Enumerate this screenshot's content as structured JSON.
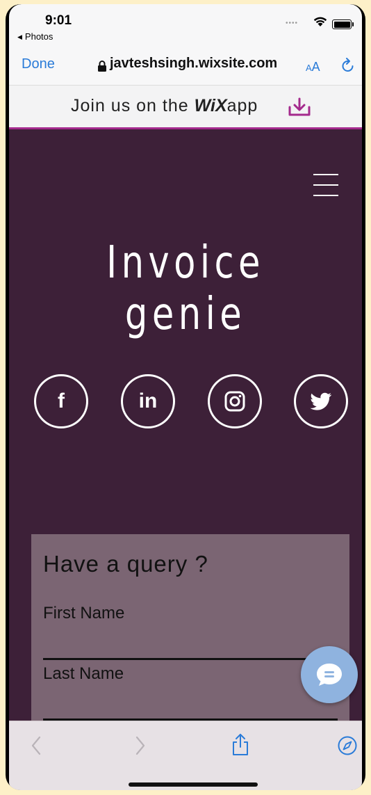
{
  "status_bar": {
    "time": "9:01",
    "back_app": "Photos"
  },
  "browser": {
    "done_label": "Done",
    "url": "javteshsingh.wixsite.com",
    "text_size_small": "A",
    "text_size_large": "A"
  },
  "banner": {
    "prefix": "Join us on the ",
    "brand": "WiX",
    "suffix": "app"
  },
  "site": {
    "title": "Invoice genie",
    "social": [
      {
        "name": "facebook",
        "glyph": "f"
      },
      {
        "name": "linkedin",
        "glyph": "in"
      },
      {
        "name": "instagram",
        "glyph": ""
      },
      {
        "name": "twitter",
        "glyph": ""
      }
    ]
  },
  "form": {
    "heading": "Have a query ?",
    "first_name_label": "First Name",
    "last_name_label": "Last Name"
  },
  "colors": {
    "site_bg": "#3d2038",
    "form_bg": "#7b6573",
    "accent_link": "#2a7bd8",
    "banner_accent": "#a42a8d",
    "chat_bubble": "#8fb3df"
  }
}
